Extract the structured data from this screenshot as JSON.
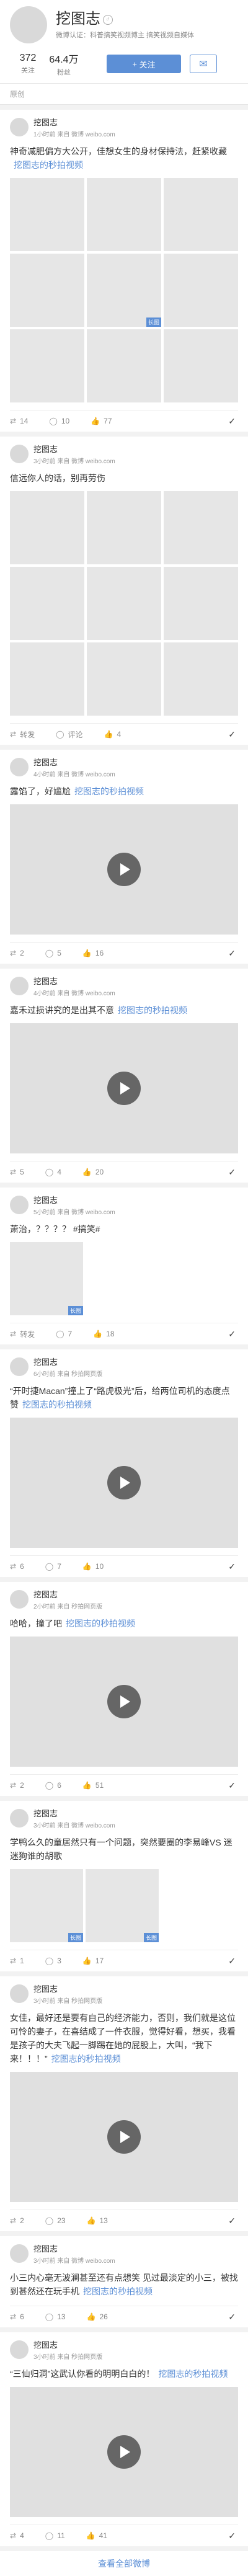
{
  "profile": {
    "name": "挖图志",
    "verify": "微博认证：科普搞笑视频博主 搞笑视频自媒体",
    "stats": [
      {
        "num": "372",
        "label": "关注"
      },
      {
        "num": "64.4万",
        "label": "粉丝"
      }
    ],
    "follow_label": "关注",
    "tab_label": "原创"
  },
  "posts": [
    {
      "author": "挖图志",
      "time": "1小时前 来自 微博 weibo.com",
      "text": "神奇减肥偏方大公开，佳想女生的身材保持法，赶紧收藏",
      "link": "挖图志的秒拍视频",
      "media": "images9",
      "long_index": 4,
      "repost": "14",
      "comment": "10",
      "like": "77"
    },
    {
      "author": "挖图志",
      "time": "3小时前 来自 微博 weibo.com",
      "text": "信远你人的话，别再劳伤",
      "link": "",
      "media": "images9",
      "long_index": -1,
      "repost": "转发",
      "comment": "评论",
      "like": "4"
    },
    {
      "author": "挖图志",
      "time": "4小时前 来自 微博 weibo.com",
      "text": "露馅了，好尴尬",
      "link": "挖图志的秒拍视频",
      "media": "video",
      "repost": "2",
      "comment": "5",
      "like": "16"
    },
    {
      "author": "挖图志",
      "time": "4小时前 来自 微博 weibo.com",
      "text": "嘉禾过损讲究的是出其不意",
      "link": "挖图志的秒拍视频",
      "media": "video",
      "repost": "5",
      "comment": "4",
      "like": "20"
    },
    {
      "author": "挖图志",
      "time": "5小时前 来自 微博 weibo.com",
      "text": "萧治，？？？？ #搞笑#",
      "link": "",
      "media": "image1",
      "repost": "转发",
      "comment": "7",
      "like": "18"
    },
    {
      "author": "挖图志",
      "time": "6小时前 来自 秒拍网页版",
      "text": "“开时捷Macan”撞上了“路虎极光”后，给两位司机的态度点赞",
      "link": "挖图志的秒拍视频",
      "media": "video",
      "repost": "6",
      "comment": "7",
      "like": "10"
    },
    {
      "author": "挖图志",
      "time": "2小时前 来自 秒拍网页版",
      "text": "哈哈，撞了吧",
      "link": "挖图志的秒拍视频",
      "media": "video",
      "repost": "2",
      "comment": "6",
      "like": "51"
    },
    {
      "author": "挖图志",
      "time": "3小时前 来自 微博 weibo.com",
      "text": "学鸭么久的童居然只有一个问题，突然要圈的李易峰VS 迷迷狗谁的胡歌",
      "link": "",
      "media": "image2",
      "repost": "1",
      "comment": "3",
      "like": "17"
    },
    {
      "author": "挖图志",
      "time": "3小时前 来自 秒拍网页版",
      "text": "女佳，最好还是要有自己的经济能力，否则，我们就是这位可怜的妻子，在喜结成了一件衣服，觉得好看，想买，我看是孩子的大夫飞起一脚踢在她的屁股上，大叫，“我下来！！！”",
      "link": "挖图志的秒拍视频",
      "media": "video",
      "repost": "2",
      "comment": "23",
      "like": "13"
    },
    {
      "author": "挖图志",
      "time": "3小时前 来自 微博 weibo.com",
      "text": "小三内心毫无波澜甚至还有点想笑 见过最淡定的小三，被找到甚然还在玩手机",
      "link": "挖图志的秒拍视频",
      "media": "none",
      "repost": "6",
      "comment": "13",
      "like": "26"
    },
    {
      "author": "挖图志",
      "time": "3小时前 来自 秒拍网页版",
      "text": "“三仙归洞”这武认你看的明明白白的！",
      "link": "挖图志的秒拍视频",
      "media": "video",
      "repost": "4",
      "comment": "11",
      "like": "41"
    }
  ],
  "footer": {
    "label": "查看全部微博"
  }
}
